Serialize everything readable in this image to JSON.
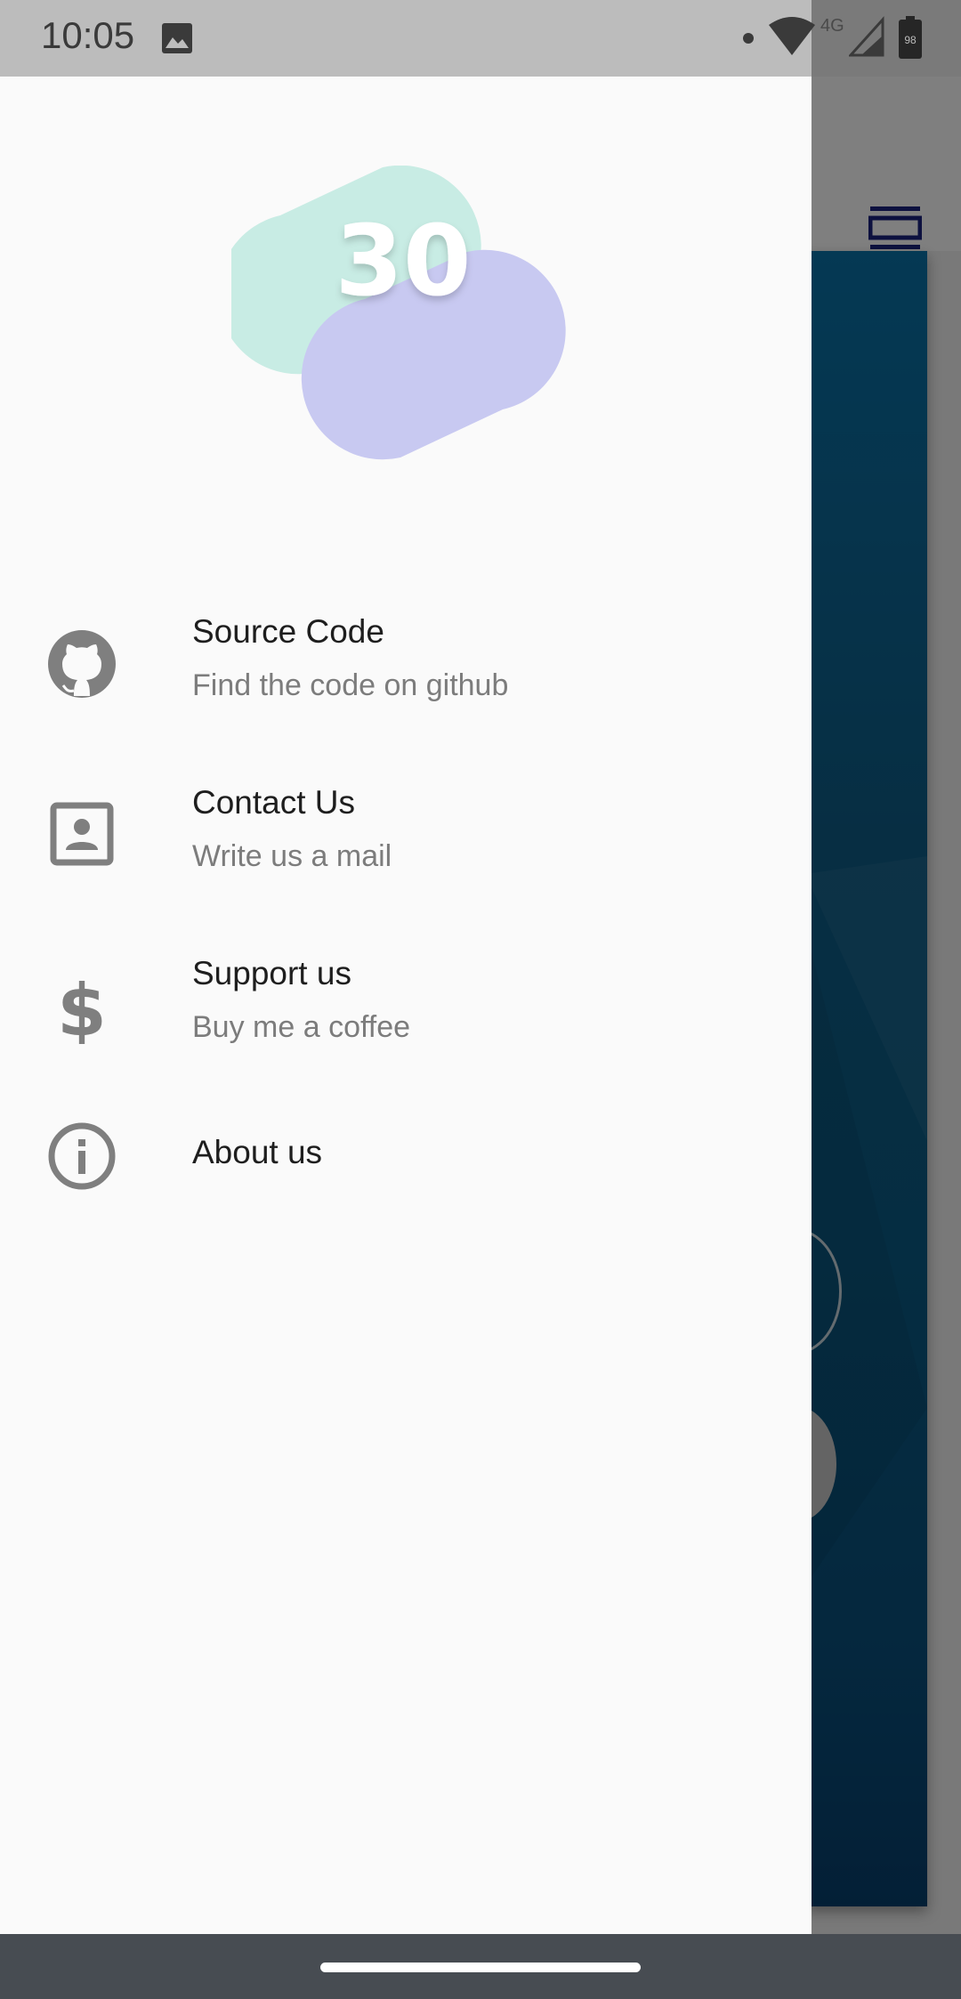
{
  "status_bar": {
    "time": "10:05",
    "network_label": "4G",
    "battery_level": "98",
    "icons": [
      "gallery-icon",
      "notification-dot",
      "wifi-icon",
      "signal-icon",
      "battery-icon"
    ]
  },
  "drawer": {
    "logo_text": "30",
    "items": [
      {
        "icon": "github-icon",
        "title": "Source Code",
        "subtitle": "Find the code on github"
      },
      {
        "icon": "contact-card-icon",
        "title": "Contact Us",
        "subtitle": "Write us a mail"
      },
      {
        "icon": "dollar-icon",
        "title": "Support us",
        "subtitle": "Buy me a coffee"
      },
      {
        "icon": "info-icon",
        "title": "About us"
      }
    ]
  },
  "colors": {
    "drawer_bg": "#fafafa",
    "icon_gray": "#7f7f7f",
    "logo_mint": "#c8ece4",
    "logo_lavender": "#c8c9f1",
    "accent_navy": "#1a237e",
    "card_blue": "#0a5f8c",
    "nav_bar": "#474c52"
  }
}
